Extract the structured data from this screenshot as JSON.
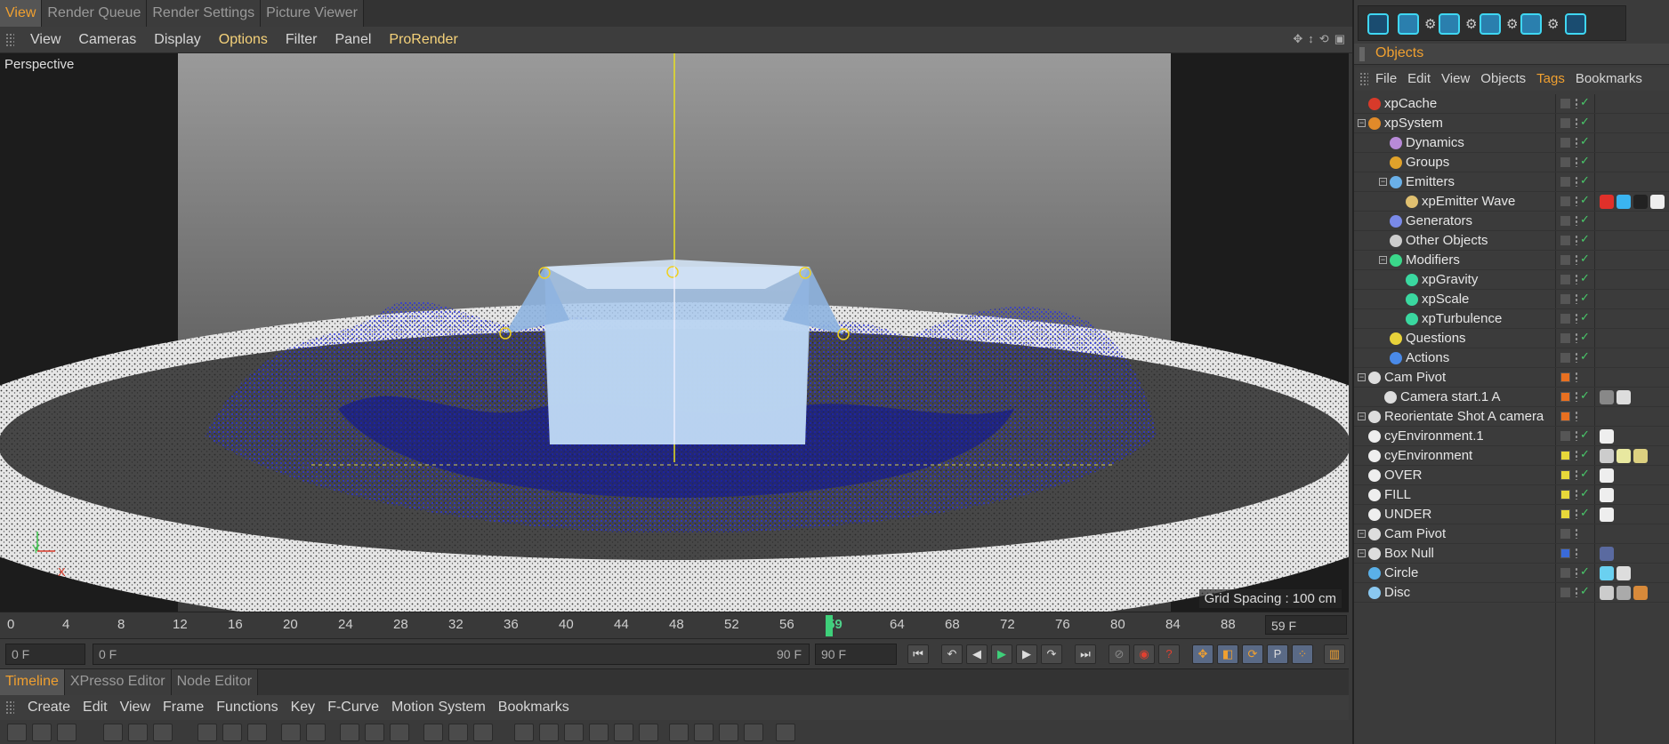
{
  "top_tabs": [
    "View",
    "Render Queue",
    "Render Settings",
    "Picture Viewer"
  ],
  "viewport_menu": [
    "View",
    "Cameras",
    "Display",
    "Options",
    "Filter",
    "Panel",
    "ProRender"
  ],
  "viewport": {
    "label": "Perspective",
    "grid_spacing": "Grid Spacing : 100 cm",
    "axis_y": "Y",
    "axis_x": "X"
  },
  "timeline": {
    "ticks": [
      "0",
      "4",
      "8",
      "12",
      "16",
      "20",
      "24",
      "28",
      "32",
      "36",
      "40",
      "44",
      "48",
      "52",
      "56",
      "59",
      "64",
      "68",
      "72",
      "76",
      "80",
      "84",
      "88"
    ],
    "current_frame_tick": "59",
    "current_frame_field": "59 F",
    "start_field": "0 F",
    "range_start": "0 F",
    "range_end": "90 F",
    "end_field": "90 F"
  },
  "bottom_tabs": [
    "Timeline",
    "XPresso Editor",
    "Node Editor"
  ],
  "timeline_menu": [
    "Create",
    "Edit",
    "View",
    "Frame",
    "Functions",
    "Key",
    "F-Curve",
    "Motion System",
    "Bookmarks"
  ],
  "objects_panel": {
    "title": "Objects",
    "menu": [
      "File",
      "Edit",
      "View",
      "Objects",
      "Tags",
      "Bookmarks"
    ],
    "items": [
      {
        "name": "xpCache",
        "icon_color": "#d83a2a"
      },
      {
        "name": "xpSystem",
        "icon_color": "#e08a2a"
      },
      {
        "name": "Dynamics",
        "icon_color": "#b88ad8"
      },
      {
        "name": "Groups",
        "icon_color": "#e0a22a"
      },
      {
        "name": "Emitters",
        "icon_color": "#6ab0e8"
      },
      {
        "name": "xpEmitter Wave",
        "icon_color": "#e0c070"
      },
      {
        "name": "Generators",
        "icon_color": "#7a8ae8"
      },
      {
        "name": "Other Objects",
        "icon_color": "#cccccc"
      },
      {
        "name": "Modifiers",
        "icon_color": "#3ad88a"
      },
      {
        "name": "xpGravity",
        "icon_color": "#3ad8a0"
      },
      {
        "name": "xpScale",
        "icon_color": "#3ad8a0"
      },
      {
        "name": "xpTurbulence",
        "icon_color": "#3ad8a0"
      },
      {
        "name": "Questions",
        "icon_color": "#e8d23a"
      },
      {
        "name": "Actions",
        "icon_color": "#4a8ae8"
      },
      {
        "name": "Cam Pivot",
        "icon_color": "#dddddd"
      },
      {
        "name": "Camera start.1 A",
        "icon_color": "#dddddd"
      },
      {
        "name": "Reorientate Shot A camera",
        "icon_color": "#dddddd"
      },
      {
        "name": "cyEnvironment.1",
        "icon_color": "#eeeeee"
      },
      {
        "name": "cyEnvironment",
        "icon_color": "#eeeeee"
      },
      {
        "name": "OVER",
        "icon_color": "#eeeeee"
      },
      {
        "name": "FILL",
        "icon_color": "#eeeeee"
      },
      {
        "name": "UNDER",
        "icon_color": "#eeeeee"
      },
      {
        "name": "Cam Pivot",
        "icon_color": "#dddddd"
      },
      {
        "name": "Box Null",
        "icon_color": "#dddddd"
      },
      {
        "name": "Circle",
        "icon_color": "#5ab0e8"
      },
      {
        "name": "Disc",
        "icon_color": "#8ac8f0"
      }
    ]
  },
  "colors": {
    "accent_orange": "#f0a030",
    "highlight_yellow": "#f5d27a",
    "current_frame_green": "#4fd08a",
    "particle_blue": "#1f2bd8"
  }
}
